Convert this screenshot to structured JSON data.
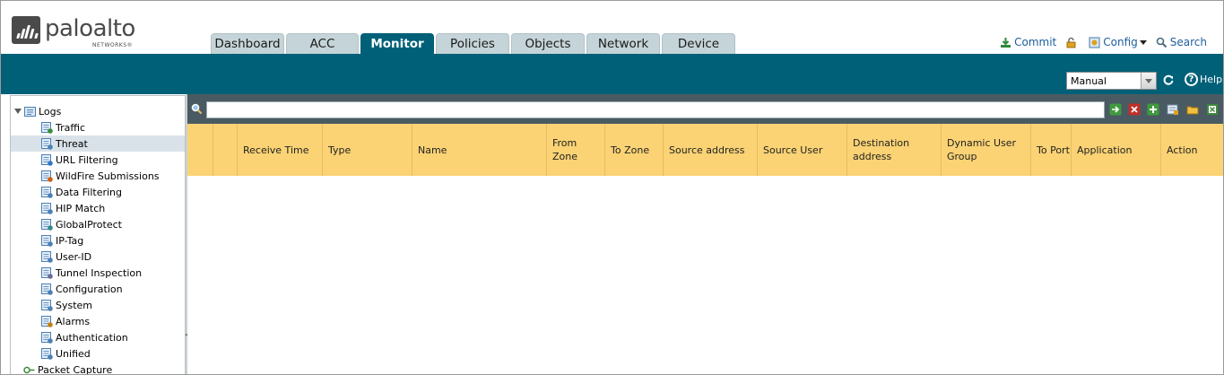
{
  "brand": {
    "name": "paloalto",
    "sub": "NETWORKS®"
  },
  "tabs": [
    {
      "label": "Dashboard",
      "active": false
    },
    {
      "label": "ACC",
      "active": false
    },
    {
      "label": "Monitor",
      "active": true
    },
    {
      "label": "Policies",
      "active": false
    },
    {
      "label": "Objects",
      "active": false
    },
    {
      "label": "Network",
      "active": false
    },
    {
      "label": "Device",
      "active": false
    }
  ],
  "toplinks": {
    "commit": "Commit",
    "config": "Config",
    "search": "Search"
  },
  "toolbar": {
    "refresh_mode": "Manual",
    "help": "Help"
  },
  "sidebar": {
    "root": "Logs",
    "items": [
      {
        "label": "Traffic",
        "icon": "traffic-log-icon"
      },
      {
        "label": "Threat",
        "icon": "threat-log-icon",
        "selected": true
      },
      {
        "label": "URL Filtering",
        "icon": "url-filtering-icon"
      },
      {
        "label": "WildFire Submissions",
        "icon": "wildfire-icon"
      },
      {
        "label": "Data Filtering",
        "icon": "data-filtering-icon"
      },
      {
        "label": "HIP Match",
        "icon": "hip-match-icon"
      },
      {
        "label": "GlobalProtect",
        "icon": "globalprotect-icon"
      },
      {
        "label": "IP-Tag",
        "icon": "ip-tag-icon"
      },
      {
        "label": "User-ID",
        "icon": "user-id-icon"
      },
      {
        "label": "Tunnel Inspection",
        "icon": "tunnel-inspection-icon"
      },
      {
        "label": "Configuration",
        "icon": "configuration-icon"
      },
      {
        "label": "System",
        "icon": "system-icon"
      },
      {
        "label": "Alarms",
        "icon": "alarms-icon"
      },
      {
        "label": "Authentication",
        "icon": "authentication-icon"
      },
      {
        "label": "Unified",
        "icon": "unified-icon"
      }
    ],
    "next_root": "Packet Capture"
  },
  "filter": {
    "value": ""
  },
  "columns": [
    {
      "line1": "",
      "line2": ""
    },
    {
      "line1": "",
      "line2": ""
    },
    {
      "line1": "Receive Time",
      "line2": ""
    },
    {
      "line1": "Type",
      "line2": ""
    },
    {
      "line1": "Name",
      "line2": ""
    },
    {
      "line1": "From Zone",
      "line2": ""
    },
    {
      "line1": "To Zone",
      "line2": ""
    },
    {
      "line1": "Source address",
      "line2": ""
    },
    {
      "line1": "Source User",
      "line2": ""
    },
    {
      "line1": "Destination",
      "line2": "address"
    },
    {
      "line1": "Dynamic User",
      "line2": "Group"
    },
    {
      "line1": "To Port",
      "line2": ""
    },
    {
      "line1": "Application",
      "line2": ""
    },
    {
      "line1": "Action",
      "line2": ""
    }
  ],
  "colors": {
    "brand_teal": "#006078",
    "header_yellow": "#fbd374",
    "filter_bar": "#4a5a62",
    "link_blue": "#1d5e9c"
  }
}
